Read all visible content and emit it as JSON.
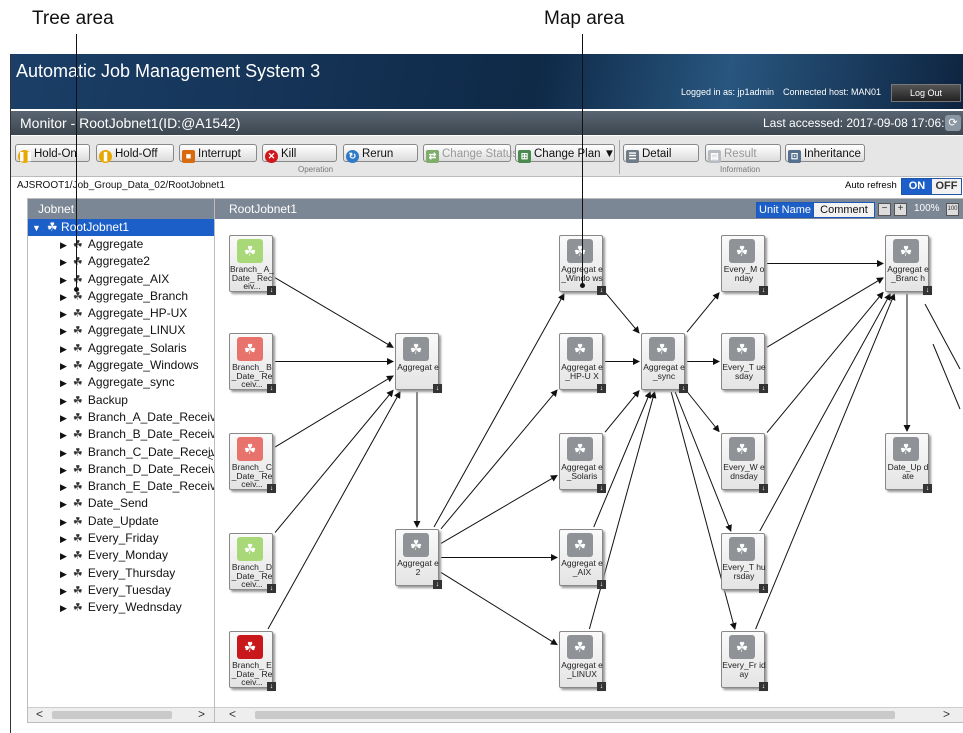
{
  "annotations": {
    "tree_area": "Tree area",
    "map_area": "Map area"
  },
  "app": {
    "title": "Automatic Job Management System 3",
    "logged_in": "Logged in as: jp1admin",
    "connected": "Connected host: MAN01",
    "logout": "Log Out"
  },
  "monitor": {
    "title": "Monitor - RootJobnet1(ID:@A1542)",
    "last_accessed": "Last accessed: 2017-09-08 17:06:31"
  },
  "toolbar": {
    "hold_on": "Hold-On",
    "hold_off": "Hold-Off",
    "interrupt": "Interrupt",
    "kill": "Kill",
    "rerun": "Rerun",
    "change_status": "Change Status",
    "change_plan": "Change Plan ▼",
    "detail": "Detail",
    "result": "Result",
    "inheritance": "Inheritance",
    "group_operation": "Operation",
    "group_information": "Information"
  },
  "path": "AJSROOT1/Job_Group_Data_02/RootJobnet1",
  "auto_refresh": {
    "label": "Auto refresh",
    "on": "ON",
    "off": "OFF"
  },
  "tree": {
    "header": "Jobnet",
    "root": "RootJobnet1",
    "items": [
      "Aggregate",
      "Aggregate2",
      "Aggregate_AIX",
      "Aggregate_Branch",
      "Aggregate_HP-UX",
      "Aggregate_LINUX",
      "Aggregate_Solaris",
      "Aggregate_Windows",
      "Aggregate_sync",
      "Backup",
      "Branch_A_Date_Receive",
      "Branch_B_Date_Receive",
      "Branch_C_Date_Receive",
      "Branch_D_Date_Receive",
      "Branch_E_Date_Receive",
      "Date_Send",
      "Date_Update",
      "Every_Friday",
      "Every_Monday",
      "Every_Thursday",
      "Every_Tuesday",
      "Every_Wednsday"
    ]
  },
  "map": {
    "title": "RootJobnet1",
    "unit_name": "Unit Name",
    "comment": "Comment",
    "zoom": "100%",
    "colors": {
      "green": "#a8d878",
      "red": "#e8736c",
      "darkred": "#c8181c",
      "grey": "#8f9397"
    },
    "nodes": [
      {
        "id": "ba",
        "label": "Branch_ A_Date_ Receiv...",
        "color": "green"
      },
      {
        "id": "bb",
        "label": "Branch_ B_Date_ Receiv...",
        "color": "red"
      },
      {
        "id": "bc",
        "label": "Branch_ C_Date_ Receiv...",
        "color": "red"
      },
      {
        "id": "bd",
        "label": "Branch_ D_Date_ Receiv...",
        "color": "green"
      },
      {
        "id": "be",
        "label": "Branch_ E_Date_ Receiv...",
        "color": "darkred"
      },
      {
        "id": "ag",
        "label": "Aggregat e",
        "color": "grey"
      },
      {
        "id": "ag2",
        "label": "Aggregat e2",
        "color": "grey"
      },
      {
        "id": "win",
        "label": "Aggregat e_Windo ws",
        "color": "grey"
      },
      {
        "id": "hp",
        "label": "Aggregat e_HP-U X",
        "color": "grey"
      },
      {
        "id": "sol",
        "label": "Aggregat e_Solaris",
        "color": "grey"
      },
      {
        "id": "aix",
        "label": "Aggregat e_AIX",
        "color": "grey"
      },
      {
        "id": "lin",
        "label": "Aggregat e_LINUX",
        "color": "grey"
      },
      {
        "id": "sync",
        "label": "Aggregat e_sync",
        "color": "grey"
      },
      {
        "id": "mon",
        "label": "Every_M onday",
        "color": "grey"
      },
      {
        "id": "tue",
        "label": "Every_T uesday",
        "color": "grey"
      },
      {
        "id": "wed",
        "label": "Every_W ednsday",
        "color": "grey"
      },
      {
        "id": "thu",
        "label": "Every_T hursday",
        "color": "grey"
      },
      {
        "id": "fri",
        "label": "Every_Fr iday",
        "color": "grey"
      },
      {
        "id": "br",
        "label": "Aggregat e_Branc h",
        "color": "grey"
      },
      {
        "id": "du",
        "label": "Date_Up date",
        "color": "grey"
      }
    ],
    "edges": [
      [
        "ba",
        "ag"
      ],
      [
        "bb",
        "ag"
      ],
      [
        "bc",
        "ag"
      ],
      [
        "bd",
        "ag"
      ],
      [
        "be",
        "ag"
      ],
      [
        "ag",
        "ag2"
      ],
      [
        "ag2",
        "win"
      ],
      [
        "ag2",
        "hp"
      ],
      [
        "ag2",
        "sol"
      ],
      [
        "ag2",
        "aix"
      ],
      [
        "ag2",
        "lin"
      ],
      [
        "win",
        "sync"
      ],
      [
        "hp",
        "sync"
      ],
      [
        "sol",
        "sync"
      ],
      [
        "aix",
        "sync"
      ],
      [
        "lin",
        "sync"
      ],
      [
        "sync",
        "mon"
      ],
      [
        "sync",
        "tue"
      ],
      [
        "sync",
        "wed"
      ],
      [
        "sync",
        "thu"
      ],
      [
        "sync",
        "fri"
      ],
      [
        "mon",
        "br"
      ],
      [
        "tue",
        "br"
      ],
      [
        "wed",
        "br"
      ],
      [
        "thu",
        "br"
      ],
      [
        "fri",
        "br"
      ],
      [
        "br",
        "du"
      ]
    ]
  }
}
